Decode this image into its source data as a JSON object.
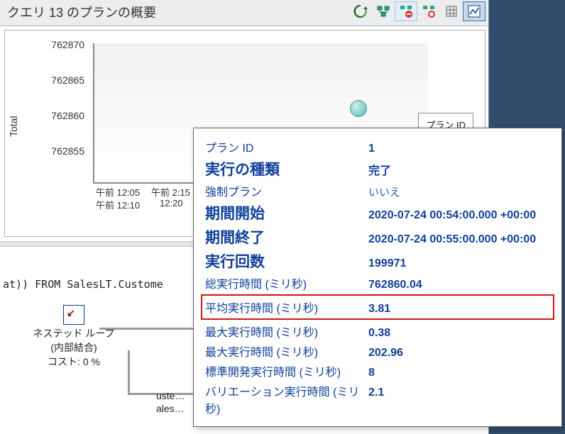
{
  "title": "クエリ 13 のプランの概要",
  "legend_label": "プラン ID",
  "chart_data": {
    "type": "scatter",
    "ylabel": "Total",
    "yticks": [
      "762870",
      "762865",
      "762860",
      "762855"
    ],
    "xticks_top": [
      "午前 12:05",
      "午前 2:15"
    ],
    "xticks_bot": [
      "午前 12:10",
      "12:20"
    ],
    "point": {
      "x_rel": 0.78,
      "y_rel": 0.42,
      "plan_id": 1
    }
  },
  "sql_fragment": "at))  FROM  SalesLT.Custome",
  "plan_node": {
    "line1": "ネステッド ループ",
    "line2": "(内部結合)",
    "line3": "コスト: 0 %"
  },
  "truncated": {
    "a": "uste…",
    "b": "ales…"
  },
  "tooltip": {
    "rows": [
      {
        "label": "プラン ID",
        "value": "1",
        "big": false
      },
      {
        "label": "実行の種類",
        "value": "完了",
        "big": true
      },
      {
        "label": "強制プラン",
        "value": "いいえ",
        "big": false,
        "plain": true
      },
      {
        "label": "期間開始",
        "value": "2020-07-24 00:54:00.000 +00:00",
        "big": true
      },
      {
        "label": "期間終了",
        "value": "2020-07-24 00:55:00.000 +00:00",
        "big": true
      },
      {
        "label": "実行回数",
        "value": "199971",
        "big": true
      },
      {
        "label": "総実行時間 (ミリ秒)",
        "value": "762860.04",
        "big": false
      },
      {
        "label": "平均実行時間 (ミリ秒)",
        "value": "3.81",
        "big": false,
        "highlight": true
      },
      {
        "label": "最大実行時間 (ミリ秒)",
        "value": "0.38",
        "big": false
      },
      {
        "label": "最大実行時間 (ミリ秒)",
        "value": "202.96",
        "big": false
      },
      {
        "label": "標準開発実行時間 (ミリ秒)",
        "value": "8",
        "big": false
      },
      {
        "label": "バリエーション実行時間 (ミリ秒)",
        "value": "2.1",
        "big": false
      }
    ]
  }
}
